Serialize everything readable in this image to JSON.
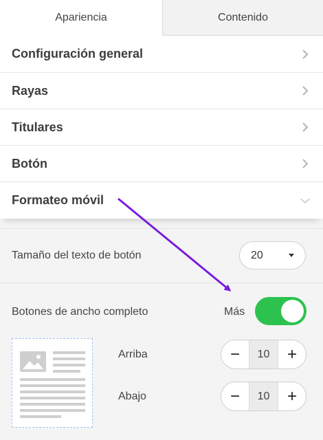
{
  "tabs": [
    {
      "label": "Apariencia",
      "active": true
    },
    {
      "label": "Contenido",
      "active": false
    }
  ],
  "accordion": [
    {
      "label": "Configuración general",
      "expanded": false
    },
    {
      "label": "Rayas",
      "expanded": false
    },
    {
      "label": "Titulares",
      "expanded": false
    },
    {
      "label": "Botón",
      "expanded": false
    },
    {
      "label": "Formateo móvil",
      "expanded": true
    }
  ],
  "settings": {
    "button_text_size": {
      "label": "Tamaño del texto de botón",
      "value": "20"
    },
    "full_width_buttons": {
      "label": "Botones de ancho completo",
      "state_label": "Más",
      "enabled": true
    },
    "padding_top": {
      "label": "Arriba",
      "value": "10",
      "minus": "−",
      "plus": "+"
    },
    "padding_bottom": {
      "label": "Abajo",
      "value": "10",
      "minus": "−",
      "plus": "+"
    }
  },
  "colors": {
    "toggle_on": "#2dc24e",
    "annotation_arrow": "#7a1be0",
    "preview_border": "#9ec3ee"
  },
  "icons": {
    "collapsed": "chevron-right-icon",
    "expanded": "chevron-down-icon",
    "preview": "image-placeholder-icon"
  }
}
